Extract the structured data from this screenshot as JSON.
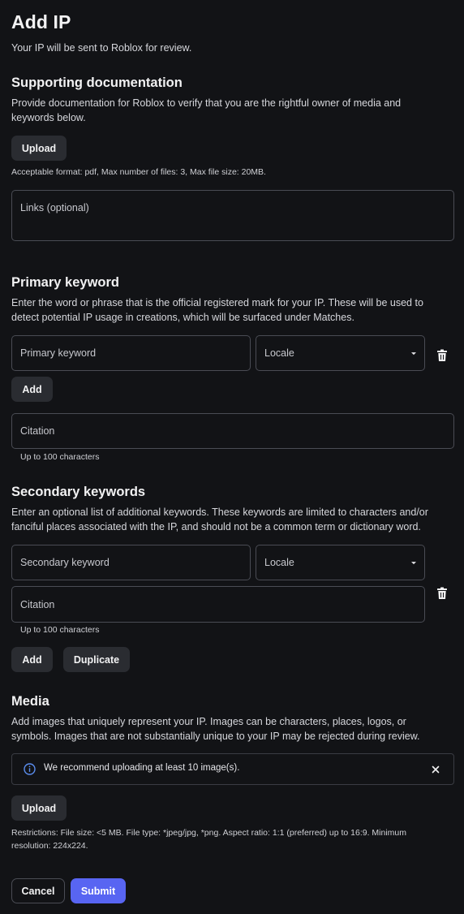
{
  "page": {
    "title": "Add IP",
    "subtitle": "Your IP will be sent to Roblox for review."
  },
  "supporting_docs": {
    "heading": "Supporting documentation",
    "description": "Provide documentation for Roblox to verify that you are the rightful owner of media and keywords below.",
    "upload_label": "Upload",
    "format_hint": "Acceptable format: pdf, Max number of files: 3, Max file size: 20MB.",
    "links_placeholder": "Links (optional)"
  },
  "primary_keyword": {
    "heading": "Primary keyword",
    "description": "Enter the word or phrase that is the official registered mark for your IP. These will be used to detect potential IP usage in creations, which will be surfaced under Matches.",
    "keyword_placeholder": "Primary keyword",
    "locale_label": "Locale",
    "add_label": "Add",
    "citation_placeholder": "Citation",
    "citation_hint": "Up to 100 characters"
  },
  "secondary_keywords": {
    "heading": "Secondary keywords",
    "description": "Enter an optional list of additional keywords. These keywords are limited to characters and/or fanciful places associated with the IP, and should not be a common term or dictionary word.",
    "keyword_placeholder": "Secondary keyword",
    "locale_label": "Locale",
    "citation_placeholder": "Citation",
    "citation_hint": "Up to 100 characters",
    "add_label": "Add",
    "duplicate_label": "Duplicate"
  },
  "media": {
    "heading": "Media",
    "description": "Add images that uniquely represent your IP. Images can be characters, places, logos, or symbols. Images that are not substantially unique to your IP may be rejected during review.",
    "notice_text": "We recommend uploading at least 10 image(s).",
    "upload_label": "Upload",
    "restrictions": "Restrictions: File size: <5 MB. File type: *jpeg/jpg, *png. Aspect ratio: 1:1 (preferred) up to 16:9. Minimum resolution: 224x224."
  },
  "footer": {
    "cancel_label": "Cancel",
    "submit_label": "Submit"
  },
  "colors": {
    "background": "#121316",
    "button_bg": "#2a2c31",
    "submit_bg": "#5865f2",
    "info_icon": "#5a8dee"
  },
  "icons": [
    "info-icon",
    "close-icon",
    "trash-icon",
    "chevron-down-icon"
  ]
}
